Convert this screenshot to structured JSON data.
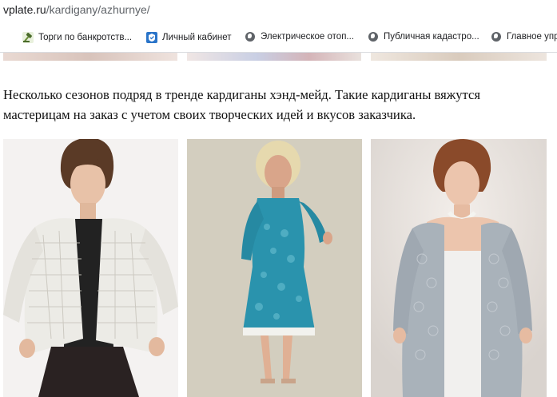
{
  "address_bar": {
    "domain": "vplate.ru",
    "path": "/kardigany/azhurnye/"
  },
  "bookmarks": [
    {
      "label": "Торги по банкротств...",
      "icon": "gavel-icon"
    },
    {
      "label": "Личный кабинет",
      "icon": "shield-icon"
    },
    {
      "label": "Электрическое отоп...",
      "icon": "globe-icon"
    },
    {
      "label": "Публичная кадастро...",
      "icon": "globe-icon"
    },
    {
      "label": "Главное упр",
      "icon": "globe-icon"
    }
  ],
  "article": {
    "paragraph_line1": "Несколько сезонов подряд в тренде кардиганы хэнд-мейд. Такие кардиганы вяжутся",
    "paragraph_line2": "мастерицам на заказ с учетом своих творческих идей и вкусов заказчика."
  },
  "photos": [
    {
      "icon": "white-lace-cardigan-photo"
    },
    {
      "icon": "blue-crochet-dress-photo"
    },
    {
      "icon": "grey-lace-cardigan-photo"
    }
  ],
  "colors": {
    "link_path": "#5f6368",
    "text": "#111111",
    "bookmark_bar_border": "#dadce0"
  }
}
